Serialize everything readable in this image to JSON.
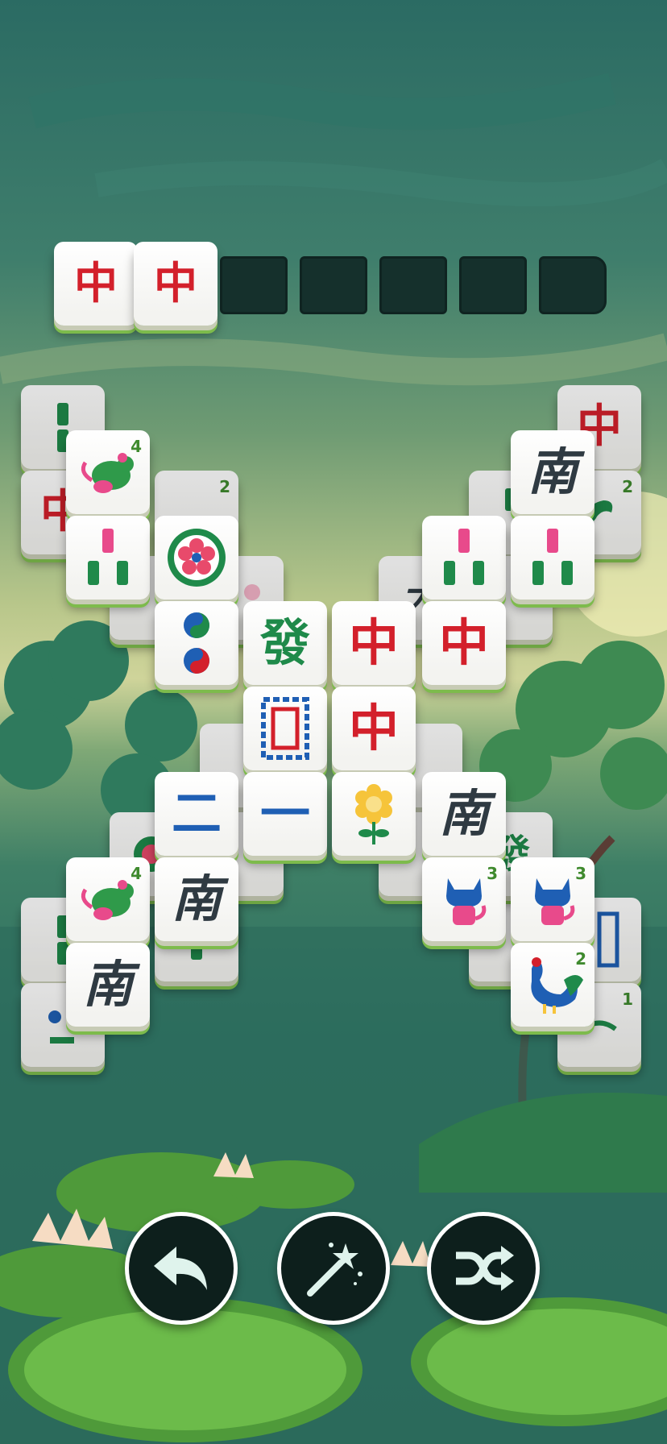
{
  "tray": {
    "tiles": [
      "中",
      "中"
    ],
    "empty_slots": 5
  },
  "board": {
    "hong_zhong": "中",
    "fa": "發",
    "nan": "南",
    "er": "二",
    "yi": "一",
    "num_4": "4",
    "num_3": "3",
    "num_2": "2",
    "num_1": "1"
  },
  "controls": {
    "undo": "undo",
    "hint": "magic-wand",
    "shuffle": "shuffle"
  },
  "colors": {
    "tile_red": "#d3202b",
    "tile_green": "#1f8a4a",
    "tile_blue": "#1f5fb4",
    "tile_dark": "#2f3a42",
    "tile_base_green": "#7dbb4c"
  }
}
